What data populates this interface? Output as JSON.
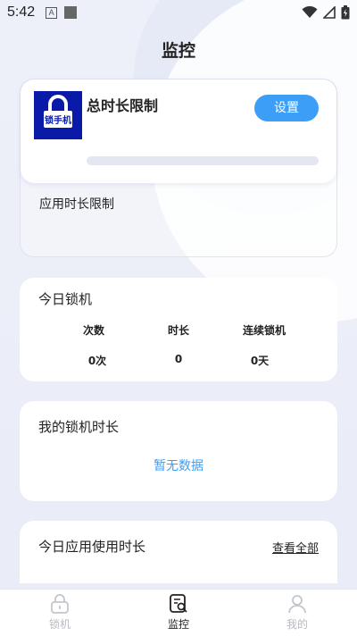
{
  "status_bar": {
    "time": "5:42",
    "notif_a": "A"
  },
  "header": {
    "title": "监控"
  },
  "limit_card": {
    "logo_text": "锁手机",
    "title": "总时长限制",
    "settings_label": "设置",
    "progress": 0,
    "app_limit_label": "应用时长限制"
  },
  "today_lock": {
    "title": "今日锁机",
    "stats": [
      {
        "label": "次数",
        "value": "0次"
      },
      {
        "label": "时长",
        "value": "0"
      },
      {
        "label": "连续锁机",
        "value": "0天"
      }
    ]
  },
  "my_lock_time": {
    "title": "我的锁机时长",
    "empty_text": "暂无数据"
  },
  "app_usage": {
    "title": "今日应用使用时长",
    "view_all_label": "查看全部"
  },
  "tabbar": {
    "tabs": [
      {
        "label": "锁机",
        "icon": "lock-icon",
        "active": false
      },
      {
        "label": "监控",
        "icon": "monitor-icon",
        "active": true
      },
      {
        "label": "我的",
        "icon": "profile-icon",
        "active": false
      }
    ]
  },
  "colors": {
    "accent": "#3d9ef7",
    "tab_active": "#222222",
    "tab_inactive": "#b8bac2",
    "logo_bg": "#0a1aa8"
  }
}
